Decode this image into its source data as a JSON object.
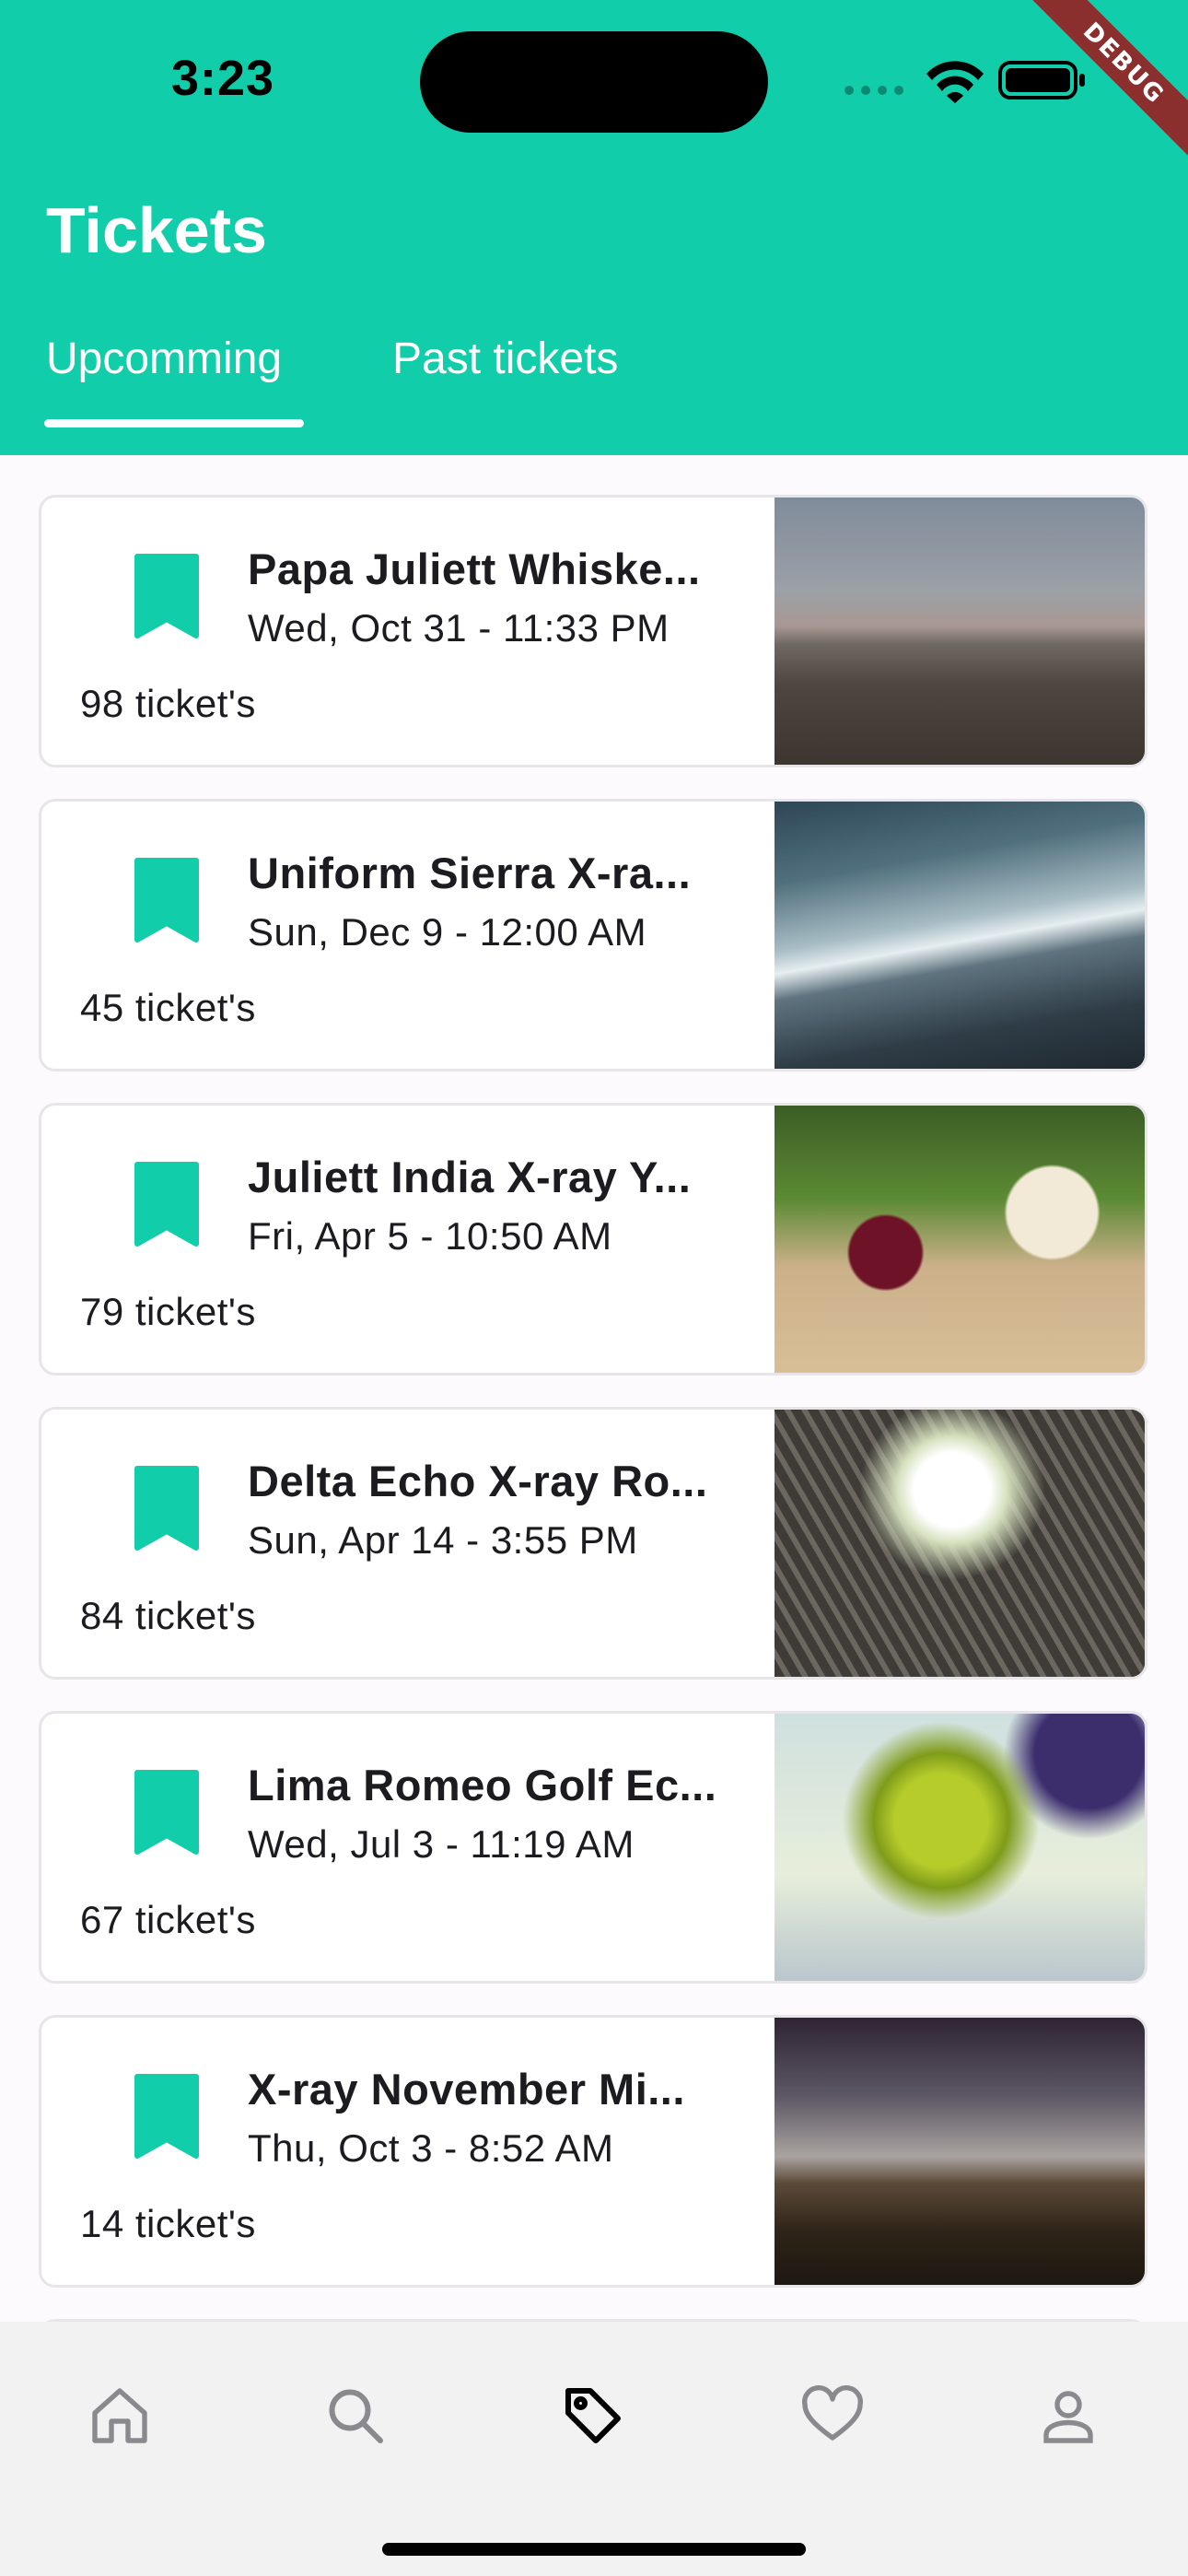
{
  "status": {
    "time": "3:23",
    "debug_label": "DEBUG"
  },
  "header": {
    "title": "Tickets",
    "tabs": [
      {
        "label": "Upcomming",
        "selected": true
      },
      {
        "label": "Past tickets",
        "selected": false
      }
    ]
  },
  "colors": {
    "accent": "#11cdaa",
    "ribbon": "#8b2e2e",
    "nav_bg": "#f3f2f3"
  },
  "tickets": [
    {
      "title": "Papa Juliett Whiske...",
      "date": "Wed, Oct 31 - 11:33 PM",
      "count": "98 ticket's",
      "image": "misty-field"
    },
    {
      "title": "Uniform Sierra X-ra...",
      "date": "Sun, Dec 9 - 12:00 AM",
      "count": "45 ticket's",
      "image": "ocean-waves"
    },
    {
      "title": "Juliett India X-ray Y...",
      "date": "Fri, Apr 5 - 10:50 AM",
      "count": "79 ticket's",
      "image": "vegetables"
    },
    {
      "title": "Delta Echo X-ray Ro...",
      "date": "Sun, Apr 14 - 3:55 PM",
      "count": "84 ticket's",
      "image": "building-skyward"
    },
    {
      "title": "Lima Romeo Golf Ec...",
      "date": "Wed, Jul 3 - 11:19 AM",
      "count": "67 ticket's",
      "image": "green-leaves"
    },
    {
      "title": "X-ray November Mi...",
      "date": "Thu, Oct 3 - 8:52 AM",
      "count": "14 ticket's",
      "image": "mountain-dusk"
    }
  ],
  "bottom_nav": [
    {
      "icon": "home-icon",
      "active": false
    },
    {
      "icon": "search-icon",
      "active": false
    },
    {
      "icon": "tag-icon",
      "active": true
    },
    {
      "icon": "heart-icon",
      "active": false
    },
    {
      "icon": "person-icon",
      "active": false
    }
  ]
}
